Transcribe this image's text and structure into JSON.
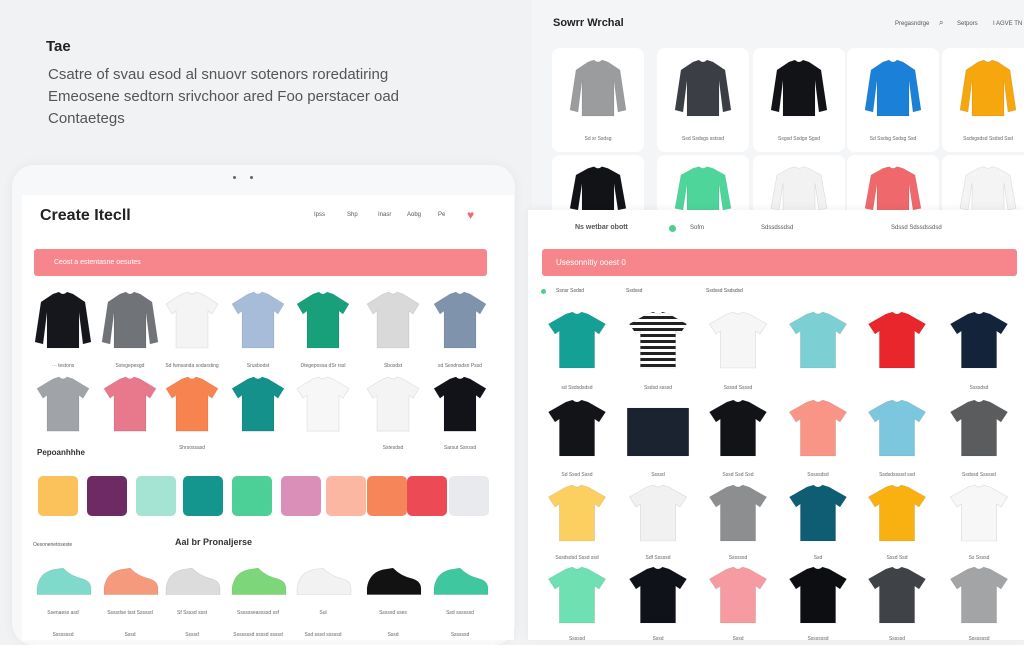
{
  "intro": {
    "title": "Tae",
    "text": "Csatre of svau esod al snuovr sotenors roredatiring Emeosene sedtorn srivchoor ared Foo perstacer oad Contaetegs"
  },
  "left": {
    "title": "Create Itecll",
    "nav": [
      "Ipss",
      "Shp",
      "Inasr",
      "Aobg",
      "Pe"
    ],
    "banner": "Ceost a estentasne oesutes",
    "shirts": [
      {
        "color": "#15171c",
        "type": "long",
        "caption": "··· testons"
      },
      {
        "color": "#707377",
        "type": "long",
        "caption": "Sstvgepesgd"
      },
      {
        "color": "#f4f4f4",
        "type": "tee",
        "caption": "Sd fwnsanda sodarsting"
      },
      {
        "color": "#a7bcd9",
        "type": "tee",
        "caption": "Srusbodst"
      },
      {
        "color": "#17a07a",
        "type": "tee",
        "caption": "Dtegepossa dSr rssl"
      },
      {
        "color": "#d9d9d9",
        "type": "tee",
        "caption": "Sbosdst"
      },
      {
        "color": "#7f93ad",
        "type": "tee",
        "caption": "sd Sesdnsdsn Pssd"
      },
      {
        "color": "#a0a3a8",
        "type": "tee",
        "caption": ""
      },
      {
        "color": "#e8788c",
        "type": "tee",
        "caption": ""
      },
      {
        "color": "#f7834f",
        "type": "tee",
        "caption": "Shrsossasd"
      },
      {
        "color": "#13918a",
        "type": "tee",
        "caption": ""
      },
      {
        "color": "#f7f7f7",
        "type": "tee",
        "caption": ""
      },
      {
        "color": "#f4f4f4",
        "type": "tee",
        "caption": "Sstesdsd"
      },
      {
        "color": "#111318",
        "type": "tee",
        "caption": "Sarsut Ssnssd"
      }
    ],
    "palette_label": "Pepoanhhhe",
    "palette": [
      "#fbc15a",
      "#6e2a63",
      "#a5e3d3",
      "#14968f",
      "#4dcf98",
      "#d98fb8",
      "#fbb7a2",
      "#f6865a",
      "#ec4b55",
      "#e8eaed"
    ],
    "shoes_side_label": "Oesonenetoseste",
    "shoes_label": "Aal br Pronaljerse",
    "shoes": [
      {
        "color": "#7fdacb",
        "caption": "Ssenaess asd"
      },
      {
        "color": "#f59a7c",
        "caption": "Ssssdse tsst Sssssd"
      },
      {
        "color": "#dcdcdc",
        "caption": "Sf Ssssd ssst"
      },
      {
        "color": "#7ed67a",
        "caption": "Sssssseassssd ssf"
      },
      {
        "color": "#f2f2f2",
        "caption": "Sul"
      },
      {
        "color": "#121212",
        "caption": "Sssssd sses"
      },
      {
        "color": "#3fc7a0",
        "caption": "Ssd ssssssd"
      }
    ],
    "footer_captions": [
      "Sssssssd",
      "Sssd",
      "Ssssd",
      "Sssssssd ssssd ssssd",
      "Ssd sssd sssssd",
      "Sssd",
      "Ssssssd"
    ]
  },
  "back": {
    "title": "Sowrr Wrchal",
    "nav": [
      "Pregasndrge",
      "Setpors",
      "I AGVE TN"
    ],
    "sweaters": [
      {
        "color": "#9b9c9e",
        "caption": "Sd sr Ssdsg"
      },
      {
        "color": "#3b3e45",
        "caption": "Ssd Ssdsgs sstssd"
      },
      {
        "color": "#121317",
        "caption": "Ssgsd Ssdgs Sgsd"
      },
      {
        "color": "#1a80d8",
        "caption": "Sd Ssdsg Ssdsg Ssd"
      },
      {
        "color": "#f6a70d",
        "caption": "Ssdsgsdsd Ssdsd Ssd"
      },
      {
        "color": "#121317",
        "caption": ""
      },
      {
        "color": "#4ed69a",
        "caption": ""
      },
      {
        "color": "#f2f2f2",
        "caption": ""
      },
      {
        "color": "#ef686c",
        "caption": ""
      },
      {
        "color": "#f4f4f4",
        "caption": ""
      }
    ]
  },
  "front": {
    "header": [
      "Ns wetbar obott",
      "Sofm",
      "Sdssdssdsd",
      "Sdssd Sdssdssdsd"
    ],
    "banner": "Usesonnitiy ooest 0",
    "meta": [
      "Ssnsr Ssdsd",
      "Ssdssd",
      "Ssdssd Ssdsdsd"
    ],
    "tees": [
      {
        "color": "#15a096",
        "caption": "sd Ssdsdsdsd"
      },
      {
        "color": "stripe",
        "caption": "Ssdsd ssssd"
      },
      {
        "color": "#f6f6f6",
        "caption": "Ssssd Ssssd"
      },
      {
        "color": "#7cd0d4",
        "caption": ""
      },
      {
        "color": "#e8262b",
        "caption": ""
      },
      {
        "color": "#13243a",
        "caption": "Ssssdsd"
      },
      {
        "color": "#121418",
        "caption": "Sd Sssd Sssd"
      },
      {
        "color": "#1b2230",
        "caption": "Ssssd"
      },
      {
        "color": "#111317",
        "caption": "Sssd Ssd Ssd"
      },
      {
        "color": "#f99586",
        "caption": "Sssssdsd"
      },
      {
        "color": "#7cc6de",
        "caption": "Ssdsdssssd ssd"
      },
      {
        "color": "#5b5c5e",
        "caption": "Ssdssd Sssssd"
      },
      {
        "color": "#fbd061",
        "caption": "Sssdsdsd Sssd ssd"
      },
      {
        "color": "#f1f1f1",
        "caption": "Sdf Sssssd"
      },
      {
        "color": "#8d8e90",
        "caption": "Ssssssd"
      },
      {
        "color": "#0f5d73",
        "caption": "Ssd"
      },
      {
        "color": "#f9b111",
        "caption": "Sssd Ssd"
      },
      {
        "color": "#f7f7f7",
        "caption": "Ss Ssssd"
      },
      {
        "color": "#6fe0b1",
        "caption": "Sssssd"
      },
      {
        "color": "#0f1218",
        "caption": "Sssd"
      },
      {
        "color": "#f69ba2",
        "caption": "Sssd"
      },
      {
        "color": "#0c0e12",
        "caption": "Sssssssd"
      },
      {
        "color": "#3f4348",
        "caption": "Sssssd"
      },
      {
        "color": "#a3a4a6",
        "caption": "Sssssssd"
      }
    ]
  }
}
